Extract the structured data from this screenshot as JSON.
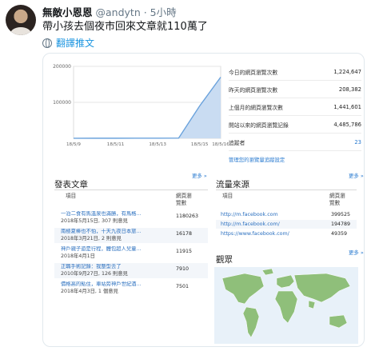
{
  "tweet": {
    "name": "無敵小恩恩",
    "handle": "@andytn",
    "time": "· 5小時",
    "text": "帶小孩去個夜市回來文章就110萬了",
    "translate": "翻譯推文"
  },
  "colors": {
    "link": "#1b95e0",
    "chart_line": "#6aa2dc",
    "chart_fill": "#c9dcf2",
    "map_land": "#8fbf7a"
  },
  "chart_data": {
    "type": "area",
    "categories": [
      "18/5/9",
      "18/5/11",
      "18/5/13",
      "18/5/15",
      "18/5/16"
    ],
    "x": [
      "18/5/9",
      "18/5/10",
      "18/5/11",
      "18/5/12",
      "18/5/13",
      "18/5/14",
      "18/5/15",
      "18/5/16"
    ],
    "series": [
      {
        "values": [
          200,
          300,
          300,
          400,
          500,
          600,
          90000,
          170000
        ]
      }
    ],
    "y_ticks": [
      "200000",
      "100000"
    ],
    "ylim": [
      0,
      200000
    ],
    "grid": true
  },
  "stats": {
    "rows": [
      {
        "label": "今日的網頁瀏覽次數",
        "value": "1,224,647"
      },
      {
        "label": "昨天的網頁瀏覽次數",
        "value": "208,382"
      },
      {
        "label": "上個月的網頁瀏覽次數",
        "value": "1,441,601"
      },
      {
        "label": "開站以來的網頁瀏覽記錄",
        "value": "4,485,786"
      },
      {
        "label": "追蹤者",
        "value": "23"
      }
    ],
    "manage_link": "管理您的瀏覽量追蹤設定"
  },
  "posts": {
    "title": "發表文章",
    "more": "更多 »",
    "col_item": "項目",
    "col_views_1": "網頁瀏",
    "col_views_2": "覽數",
    "rows": [
      {
        "title": "一泊二食有馬溫泉也滿勝，有馬格...",
        "date": "2018年5月15日, 307 則意見",
        "value": "1180263"
      },
      {
        "title": "南極夏棒也不怕，十天九夜日本旅...",
        "date": "2018年3月21日, 2 則意見",
        "value": "16178"
      },
      {
        "title": "神戶親子遊是行程，體包超人兒童...",
        "date": "2018年4月1日",
        "value": "11915"
      },
      {
        "title": "正職手術記錄：我整型去了",
        "date": "2010年9月27日, 126 則意見",
        "value": "7910"
      },
      {
        "title": "價格高的點住，車站旁神戶世紀酒...",
        "date": "2018年4月3日, 1 個意見",
        "value": "7501"
      }
    ]
  },
  "traffic": {
    "title": "流量來源",
    "more": "更多 »",
    "col_item": "項目",
    "col_views_1": "網頁瀏",
    "col_views_2": "覽數",
    "rows": [
      {
        "url": "http://m.facebook.com",
        "value": "399525"
      },
      {
        "url": "http://m.facebook.com/",
        "value": "194789"
      },
      {
        "url": "https://www.facebook.com/",
        "value": "49359"
      }
    ]
  },
  "audience": {
    "title": "觀眾",
    "more": "更多 »"
  }
}
